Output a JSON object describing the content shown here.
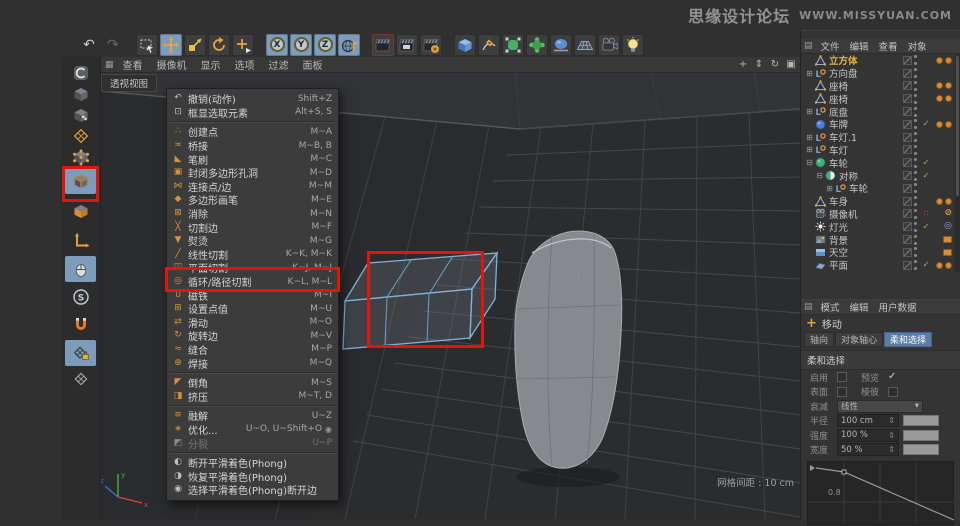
{
  "watermark": {
    "site_name": "思缘设计论坛",
    "site_url": "WWW.MISSYUAN.COM"
  },
  "toolbar": {
    "buttons": [
      {
        "name": "undo"
      },
      {
        "name": "redo",
        "dim": true
      },
      {
        "sep": true
      },
      {
        "name": "live-selection"
      },
      {
        "name": "move",
        "active": true
      },
      {
        "name": "scale"
      },
      {
        "name": "rotate"
      },
      {
        "name": "last-tool"
      },
      {
        "sep": true
      },
      {
        "name": "x-axis-lock",
        "letter": "X",
        "active": true
      },
      {
        "name": "y-axis-lock",
        "letter": "Y",
        "active": true
      },
      {
        "name": "z-axis-lock",
        "letter": "Z",
        "active": true
      },
      {
        "name": "coordinate-system",
        "active": true
      },
      {
        "sep": true
      },
      {
        "name": "render-view",
        "redline": true
      },
      {
        "name": "render-picture-viewer"
      },
      {
        "name": "render-settings"
      },
      {
        "sep": true
      },
      {
        "name": "primitive-cube"
      },
      {
        "name": "spline-pen"
      },
      {
        "name": "subdivision-surface"
      },
      {
        "name": "deformer"
      },
      {
        "name": "environment"
      },
      {
        "name": "floor"
      },
      {
        "name": "scene-camera"
      },
      {
        "name": "scene-light"
      }
    ]
  },
  "left_toolbar": {
    "items": [
      {
        "name": "make-editable"
      },
      {
        "name": "model-mode"
      },
      {
        "name": "texture-mode"
      },
      {
        "name": "workplane-mode"
      },
      {
        "name": "points-mode"
      },
      {
        "name": "edges-mode",
        "active": true,
        "annotated": true
      },
      {
        "name": "polygons-mode"
      },
      {
        "name": "enable-axis"
      },
      {
        "name": "viewport-solo",
        "active": true
      },
      {
        "name": "enable-snap",
        "letter": "S"
      },
      {
        "name": "quantize-magnet"
      },
      {
        "name": "workplane-snap",
        "active": true
      },
      {
        "name": "locked-workplane"
      }
    ]
  },
  "viewport": {
    "menu": [
      "查看",
      "摄像机",
      "显示",
      "选项",
      "过滤",
      "面板"
    ],
    "tab": "透视视图",
    "controls": [
      "pan-view",
      "dolly-view",
      "rotate-view",
      "toggle-views"
    ],
    "grid_spacing_label": "网格间距 : 10 cm",
    "axis": {
      "x": "x",
      "y": "y",
      "z": "z"
    }
  },
  "context_menu": {
    "items": [
      {
        "label": "撤销(动作)",
        "shortcut": "Shift+Z",
        "icon": "undo-action"
      },
      {
        "label": "框显选取元素",
        "shortcut": "Alt+S, S",
        "icon": "frame-selected"
      },
      {
        "separator": true
      },
      {
        "label": "创建点",
        "shortcut": "M~A",
        "icon": "create-point"
      },
      {
        "label": "桥接",
        "shortcut": "M~B, B",
        "icon": "bridge"
      },
      {
        "label": "笔刷",
        "shortcut": "M~C",
        "icon": "brush"
      },
      {
        "label": "封闭多边形孔洞",
        "shortcut": "M~D",
        "icon": "close-polygon-hole"
      },
      {
        "label": "连接点/边",
        "shortcut": "M~M",
        "icon": "connect-points-edges"
      },
      {
        "label": "多边形画笔",
        "shortcut": "M~E",
        "icon": "polygon-pen"
      },
      {
        "label": "消除",
        "shortcut": "M~N",
        "icon": "dissolve"
      },
      {
        "label": "切割边",
        "shortcut": "M~F",
        "icon": "edge-cut"
      },
      {
        "label": "熨烫",
        "shortcut": "M~G",
        "icon": "iron"
      },
      {
        "label": "线性切割",
        "shortcut": "K~K, M~K",
        "icon": "line-cut"
      },
      {
        "label": "平面切割",
        "shortcut": "K~J, M~J",
        "icon": "plane-cut"
      },
      {
        "label": "循环/路径切割",
        "shortcut": "K~L, M~L",
        "icon": "loop-path-cut",
        "annotated": true
      },
      {
        "label": "磁铁",
        "shortcut": "M~I",
        "icon": "magnet"
      },
      {
        "label": "设置点值",
        "shortcut": "M~U",
        "icon": "set-point-value"
      },
      {
        "label": "滑动",
        "shortcut": "M~O",
        "icon": "slide"
      },
      {
        "label": "旋转边",
        "shortcut": "M~V",
        "icon": "rotate-edge"
      },
      {
        "label": "缝合",
        "shortcut": "M~P",
        "icon": "stitch-sew"
      },
      {
        "label": "焊接",
        "shortcut": "M~Q",
        "icon": "weld"
      },
      {
        "separator": true
      },
      {
        "label": "倒角",
        "shortcut": "M~S",
        "icon": "bevel"
      },
      {
        "label": "挤压",
        "shortcut": "M~T, D",
        "icon": "extrude"
      },
      {
        "separator": true
      },
      {
        "label": "融解",
        "shortcut": "U~Z",
        "icon": "melt"
      },
      {
        "label": "优化...",
        "shortcut": "U~O, U~Shift+O",
        "icon": "optimize",
        "options": true
      },
      {
        "label": "分裂",
        "shortcut": "U~P",
        "icon": "split",
        "disabled": true
      },
      {
        "separator": true
      },
      {
        "label": "断开平滑着色(Phong)",
        "shortcut": "",
        "icon": "phong-break"
      },
      {
        "label": "恢复平滑着色(Phong)",
        "shortcut": "",
        "icon": "phong-restore"
      },
      {
        "label": "选择平滑着色(Phong)断开边",
        "shortcut": "",
        "icon": "phong-select"
      }
    ]
  },
  "object_manager": {
    "menu": [
      "文件",
      "编辑",
      "查看",
      "对象"
    ],
    "objects": [
      {
        "name": "立方体",
        "depth": 0,
        "icon": "polygon-object",
        "selected": true,
        "tags": [
          "tag-orange",
          "tag-orange"
        ]
      },
      {
        "name": "方向盘",
        "depth": 0,
        "icon": "instance",
        "expand": "+",
        "tags": []
      },
      {
        "name": "座椅",
        "depth": 0,
        "icon": "polygon-object",
        "tags": [
          "tag-orange",
          "tag-orange"
        ]
      },
      {
        "name": "座椅",
        "depth": 0,
        "icon": "polygon-object",
        "tags": [
          "tag-orange",
          "tag-orange"
        ]
      },
      {
        "name": "底盘",
        "depth": 0,
        "icon": "instance",
        "expand": "+",
        "tags": []
      },
      {
        "name": "车牌",
        "depth": 0,
        "icon": "sphere-object",
        "check": true,
        "tags": [
          "tag-orange",
          "tag-orange"
        ]
      },
      {
        "name": "车灯.1",
        "depth": 0,
        "icon": "instance",
        "expand": "+",
        "tags": []
      },
      {
        "name": "车灯",
        "depth": 0,
        "icon": "instance",
        "expand": "+",
        "tags": []
      },
      {
        "name": "车轮",
        "depth": 0,
        "icon": "subdivision-object",
        "expand": "-",
        "check": true,
        "tags": []
      },
      {
        "name": "对称",
        "depth": 1,
        "icon": "symmetry-object",
        "expand": "-",
        "check": true,
        "tags": []
      },
      {
        "name": "车轮",
        "depth": 2,
        "icon": "instance",
        "expand": "+",
        "tags": []
      },
      {
        "name": "车身",
        "depth": 0,
        "icon": "polygon-object",
        "tags": [
          "tag-orange",
          "tag-orange"
        ]
      },
      {
        "name": "摄像机",
        "depth": 0,
        "icon": "camera-object",
        "keyframe_dots": true,
        "tags": [
          "tag-protect"
        ]
      },
      {
        "name": "灯光",
        "depth": 0,
        "icon": "light-object",
        "check": true,
        "tags": [
          "tag-target"
        ]
      },
      {
        "name": "背景",
        "depth": 0,
        "icon": "background-object",
        "tags": [
          "tag-film"
        ]
      },
      {
        "name": "天空",
        "depth": 0,
        "icon": "sky-object",
        "tags": [
          "tag-film"
        ]
      },
      {
        "name": "平面",
        "depth": 0,
        "icon": "plane-object",
        "check": true,
        "tags": [
          "tag-orange",
          "tag-orange"
        ]
      }
    ]
  },
  "attributes": {
    "menu": [
      "模式",
      "编辑",
      "用户数据"
    ],
    "tool_label": "移动",
    "tabs": [
      {
        "label": "轴向"
      },
      {
        "label": "对象轴心"
      },
      {
        "label": "柔和选择",
        "active": true
      }
    ],
    "section_title": "柔和选择",
    "checkboxes": [
      {
        "label": "启用",
        "checked": false
      },
      {
        "label": "预览",
        "checked": true
      },
      {
        "label": "表面",
        "checked": false
      },
      {
        "label": "棱彼",
        "checked": false
      }
    ],
    "falloff": {
      "label": "衰减",
      "value": "线性"
    },
    "sliders": [
      {
        "label": "半径",
        "value": "100 cm"
      },
      {
        "label": "强度",
        "value": "100 %"
      },
      {
        "label": "宽度",
        "value": "50 %"
      }
    ],
    "curve_label": "0.8"
  }
}
